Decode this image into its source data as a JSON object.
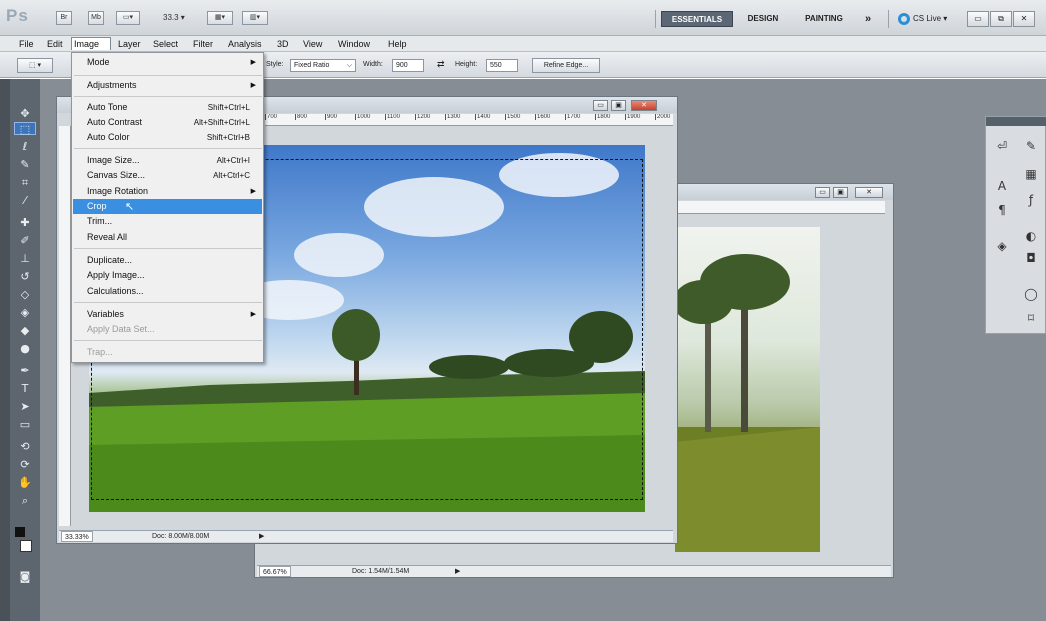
{
  "app": {
    "logo": "Ps",
    "bar_buttons": [
      "Br",
      "Mb"
    ],
    "zoom_value": "33.3",
    "workspaces": [
      "ESSENTIALS",
      "DESIGN",
      "PAINTING"
    ],
    "more_workspaces": "»",
    "cslive": "CS Live"
  },
  "menubar": [
    "File",
    "Edit",
    "Image",
    "Layer",
    "Select",
    "Filter",
    "Analysis",
    "3D",
    "View",
    "Window",
    "Help"
  ],
  "options": {
    "style_label": "Style:",
    "style_value": "Fixed Ratio",
    "width_label": "Width:",
    "width_value": "900",
    "height_label": "Height:",
    "height_value": "550",
    "refine_edge": "Refine Edge..."
  },
  "image_menu": {
    "mode": "Mode",
    "adjustments": "Adjustments",
    "auto_tone": {
      "label": "Auto Tone",
      "shortcut": "Shift+Ctrl+L"
    },
    "auto_contrast": {
      "label": "Auto Contrast",
      "shortcut": "Alt+Shift+Ctrl+L"
    },
    "auto_color": {
      "label": "Auto Color",
      "shortcut": "Shift+Ctrl+B"
    },
    "image_size": {
      "label": "Image Size...",
      "shortcut": "Alt+Ctrl+I"
    },
    "canvas_size": {
      "label": "Canvas Size...",
      "shortcut": "Alt+Ctrl+C"
    },
    "image_rotation": "Image Rotation",
    "crop": "Crop",
    "trim": "Trim...",
    "reveal_all": "Reveal All",
    "duplicate": "Duplicate...",
    "apply_image": "Apply Image...",
    "calculations": "Calculations...",
    "variables": "Variables",
    "apply_data_set": "Apply Data Set...",
    "trap": "Trap..."
  },
  "doc1": {
    "zoom": "33.33%",
    "doc_size": "Doc: 8.00M/8.00M",
    "ruler_labels": [
      "700",
      "800",
      "900",
      "1000",
      "1100",
      "1200",
      "1300",
      "1400",
      "1500",
      "1600",
      "1700",
      "1800",
      "1900",
      "2000"
    ]
  },
  "doc2": {
    "zoom": "66.67%",
    "doc_size": "Doc: 1.54M/1.54M"
  }
}
